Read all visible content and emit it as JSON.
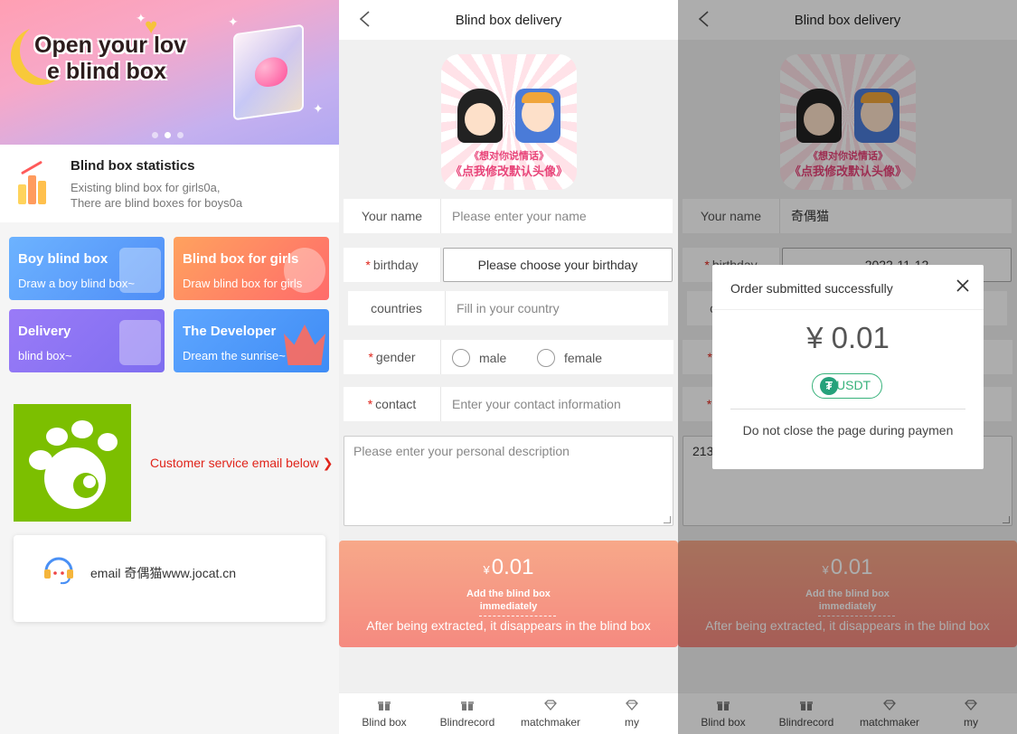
{
  "home": {
    "banner": {
      "headline_line1": "Open your lov",
      "headline_line2": "e blind box",
      "slide_count": 3,
      "active_slide": 2
    },
    "statistics": {
      "title": "Blind box statistics",
      "line1": "Existing blind box for girls0a,",
      "line2": "There are blind boxes for boys0a",
      "icon": "bar-chart-icon"
    },
    "cards": [
      {
        "title": "Boy blind box",
        "subtitle": "Draw a boy blind box~",
        "color_from": "#6db3ff",
        "color_to": "#4f8ef7"
      },
      {
        "title": "Blind box for girls",
        "subtitle": "Draw blind box for girls",
        "color_from": "#ffa25e",
        "color_to": "#ff6b6b"
      },
      {
        "title": "Delivery",
        "subtitle": "blind box~",
        "color_from": "#9a7bf7",
        "color_to": "#7e6df0"
      },
      {
        "title": "The Developer",
        "subtitle": "Dream the sunrise~",
        "color_from": "#5ea6ff",
        "color_to": "#3f8cf5"
      }
    ],
    "customer_service_link": "Customer service email below",
    "email_text": "email 奇偶猫www.jocat.cn",
    "logo_icon": "paw-icon",
    "support_icon": "headset-icon"
  },
  "form": {
    "title": "Blind box delivery",
    "avatar_caption1": "《想对你说情话》",
    "avatar_caption2": "《点我修改默认头像》",
    "fields": {
      "name_label": "Your name",
      "name_placeholder": "Please enter your name",
      "birthday_label": "birthday",
      "birthday_placeholder": "Please choose your birthday",
      "countries_label": "countries",
      "countries_placeholder": "Fill in your country",
      "gender_label": "gender",
      "gender_male": "male",
      "gender_female": "female",
      "contact_label": "contact",
      "contact_placeholder": "Enter your contact information",
      "description_placeholder": "Please enter your personal description"
    },
    "pay": {
      "currency": "¥",
      "amount": "0.01",
      "add_line1": "Add the blind box",
      "add_line2": "immediately",
      "note": "After being extracted, it disappears in the blind box"
    },
    "tabs": [
      {
        "label": "Blind box",
        "icon": "gift-icon"
      },
      {
        "label": "Blindrecord",
        "icon": "gift-icon"
      },
      {
        "label": "matchmaker",
        "icon": "diamond-icon"
      },
      {
        "label": "my",
        "icon": "diamond-icon"
      }
    ]
  },
  "filled": {
    "name_value": "奇偶猫",
    "birthday_value": "2022-11-12",
    "description_value": "213"
  },
  "modal": {
    "title": "Order submitted successfully",
    "amount": "¥ 0.01",
    "pay_method": "USDT",
    "message": "Do not close the page during paymen"
  }
}
